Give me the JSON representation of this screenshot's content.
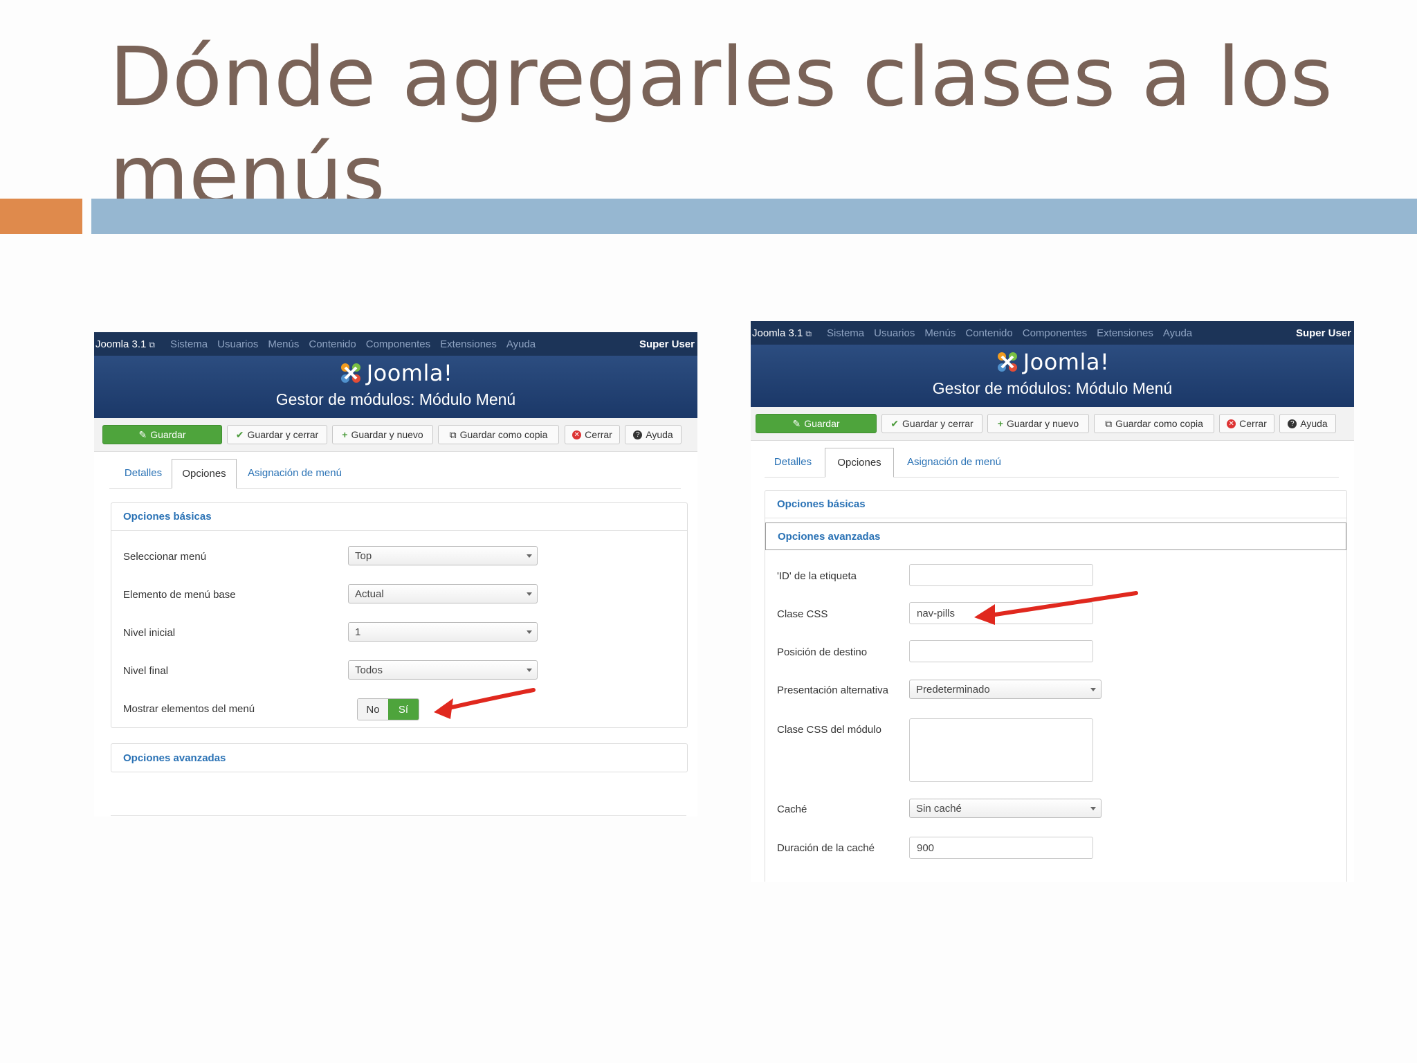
{
  "slide": {
    "title": "Dónde agregarles clases a los menús",
    "colors": {
      "title": "#7a6358",
      "bar_orange": "#df8a4c",
      "bar_blue": "#96b7d1"
    }
  },
  "screenshots": [
    {
      "app": "Joomla 3.1",
      "nav": [
        "Sistema",
        "Usuarios",
        "Menús",
        "Contenido",
        "Componentes",
        "Extensiones",
        "Ayuda"
      ],
      "user": "Super User",
      "logo_text": "Joomla!",
      "header_title": "Gestor de módulos: Módulo Menú",
      "toolbar": [
        "Guardar",
        "Guardar y cerrar",
        "Guardar y nuevo",
        "Guardar como copia",
        "Cerrar",
        "Ayuda"
      ],
      "tabs": [
        "Detalles",
        "Opciones",
        "Asignación de menú"
      ],
      "active_tab": "Opciones",
      "basic_options": {
        "heading": "Opciones básicas",
        "fields": [
          {
            "label": "Seleccionar menú",
            "value": "Top"
          },
          {
            "label": "Elemento de menú base",
            "value": "Actual"
          },
          {
            "label": "Nivel inicial",
            "value": "1"
          },
          {
            "label": "Nivel final",
            "value": "Todos"
          }
        ],
        "toggle": {
          "label": "Mostrar elementos del menú",
          "no": "No",
          "yes": "Sí",
          "selected": "Sí"
        }
      },
      "advanced_heading": "Opciones avanzadas"
    },
    {
      "app": "Joomla 3.1",
      "nav": [
        "Sistema",
        "Usuarios",
        "Menús",
        "Contenido",
        "Componentes",
        "Extensiones",
        "Ayuda"
      ],
      "user": "Super User",
      "logo_text": "Joomla!",
      "header_title": "Gestor de módulos: Módulo Menú",
      "toolbar": [
        "Guardar",
        "Guardar y cerrar",
        "Guardar y nuevo",
        "Guardar como copia",
        "Cerrar",
        "Ayuda"
      ],
      "tabs": [
        "Detalles",
        "Opciones",
        "Asignación de menú"
      ],
      "active_tab": "Opciones",
      "basic_heading": "Opciones básicas",
      "advanced_options": {
        "heading": "Opciones avanzadas",
        "fields": [
          {
            "label": "'ID' de la etiqueta",
            "value": ""
          },
          {
            "label": "Clase CSS",
            "value": "nav-pills"
          },
          {
            "label": "Posición de destino",
            "value": ""
          },
          {
            "label": "Presentación alternativa",
            "value": "Predeterminado"
          },
          {
            "label": "Clase CSS del módulo",
            "value": ""
          },
          {
            "label": "Caché",
            "value": "Sin caché"
          },
          {
            "label": "Duración de la caché",
            "value": "900"
          }
        ]
      }
    }
  ]
}
